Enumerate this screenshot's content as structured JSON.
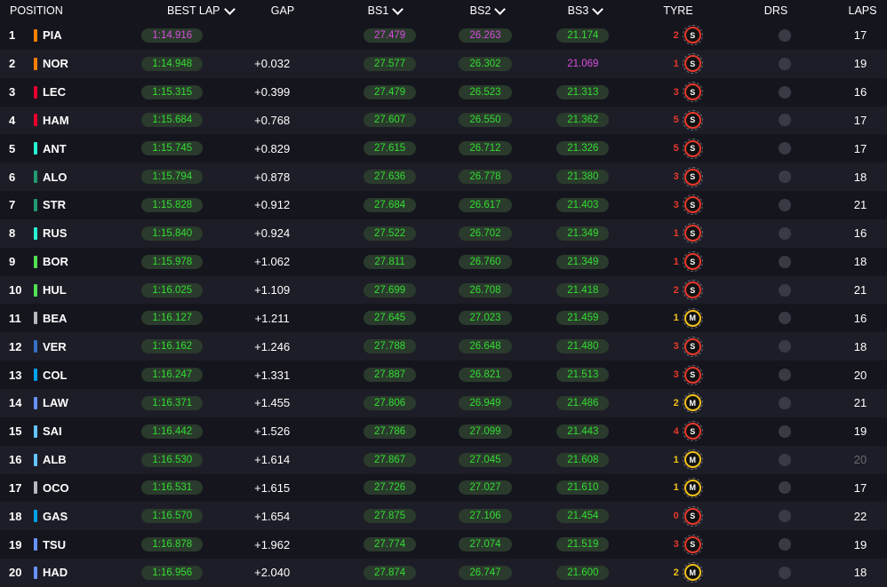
{
  "headers": {
    "position": "POSITION",
    "best_lap": "BEST LAP",
    "gap": "GAP",
    "bs1": "BS1",
    "bs2": "BS2",
    "bs3": "BS3",
    "tyre": "TYRE",
    "drs": "DRS",
    "laps": "LAPS"
  },
  "colors": {
    "pill_bg": "#2a3a2c",
    "green": "#33dd33",
    "purple": "#d94ee0",
    "soft": "#e8392b",
    "medium": "#f2c11b"
  },
  "rows": [
    {
      "pos": "1",
      "team_color": "#ff8000",
      "driver": "PIA",
      "best": "1:14.916",
      "best_purple": true,
      "gap": "",
      "bs1": "27.479",
      "bs1_purple": true,
      "bs2": "26.263",
      "bs2_purple": true,
      "bs3": "21.174",
      "bs3_purple": false,
      "tyre_age": "2",
      "tyre": "S",
      "laps": "17"
    },
    {
      "pos": "2",
      "team_color": "#ff8000",
      "driver": "NOR",
      "best": "1:14.948",
      "gap": "+0.032",
      "bs1": "27.577",
      "bs2": "26.302",
      "bs3": "21.069",
      "bs3_purple": true,
      "tyre_age": "1",
      "tyre": "S",
      "laps": "19"
    },
    {
      "pos": "3",
      "team_color": "#e8002d",
      "driver": "LEC",
      "best": "1:15.315",
      "gap": "+0.399",
      "bs1": "27.479",
      "bs2": "26.523",
      "bs3": "21.313",
      "tyre_age": "3",
      "tyre": "S",
      "laps": "16"
    },
    {
      "pos": "4",
      "team_color": "#e8002d",
      "driver": "HAM",
      "best": "1:15.684",
      "gap": "+0.768",
      "bs1": "27.607",
      "bs2": "26.550",
      "bs3": "21.362",
      "tyre_age": "5",
      "tyre": "S",
      "laps": "17"
    },
    {
      "pos": "5",
      "team_color": "#27f4d2",
      "driver": "ANT",
      "best": "1:15.745",
      "gap": "+0.829",
      "bs1": "27.615",
      "bs2": "26.712",
      "bs3": "21.326",
      "tyre_age": "5",
      "tyre": "S",
      "laps": "17"
    },
    {
      "pos": "6",
      "team_color": "#229971",
      "driver": "ALO",
      "best": "1:15.794",
      "gap": "+0.878",
      "bs1": "27.636",
      "bs2": "26.778",
      "bs3": "21.380",
      "tyre_age": "3",
      "tyre": "S",
      "laps": "18"
    },
    {
      "pos": "7",
      "team_color": "#229971",
      "driver": "STR",
      "best": "1:15.828",
      "gap": "+0.912",
      "bs1": "27.684",
      "bs2": "26.617",
      "bs3": "21.403",
      "tyre_age": "3",
      "tyre": "S",
      "laps": "21"
    },
    {
      "pos": "8",
      "team_color": "#27f4d2",
      "driver": "RUS",
      "best": "1:15.840",
      "gap": "+0.924",
      "bs1": "27.522",
      "bs2": "26.702",
      "bs3": "21.349",
      "tyre_age": "1",
      "tyre": "S",
      "laps": "16"
    },
    {
      "pos": "9",
      "team_color": "#52e252",
      "driver": "BOR",
      "best": "1:15.978",
      "gap": "+1.062",
      "bs1": "27.811",
      "bs2": "26.760",
      "bs3": "21.349",
      "tyre_age": "1",
      "tyre": "S",
      "laps": "18"
    },
    {
      "pos": "10",
      "team_color": "#52e252",
      "driver": "HUL",
      "best": "1:16.025",
      "gap": "+1.109",
      "bs1": "27.699",
      "bs2": "26.708",
      "bs3": "21.418",
      "tyre_age": "2",
      "tyre": "S",
      "laps": "21"
    },
    {
      "pos": "11",
      "team_color": "#b6babd",
      "driver": "BEA",
      "best": "1:16.127",
      "gap": "+1.211",
      "bs1": "27.645",
      "bs2": "27.023",
      "bs3": "21.459",
      "tyre_age": "1",
      "tyre": "M",
      "laps": "16"
    },
    {
      "pos": "12",
      "team_color": "#3671c6",
      "driver": "VER",
      "best": "1:16.162",
      "gap": "+1.246",
      "bs1": "27.788",
      "bs2": "26.648",
      "bs3": "21.480",
      "tyre_age": "3",
      "tyre": "S",
      "laps": "18"
    },
    {
      "pos": "13",
      "team_color": "#00a1e8",
      "driver": "COL",
      "best": "1:16.247",
      "gap": "+1.331",
      "bs1": "27.887",
      "bs2": "26.821",
      "bs3": "21.513",
      "tyre_age": "3",
      "tyre": "S",
      "laps": "20"
    },
    {
      "pos": "14",
      "team_color": "#6692ff",
      "driver": "LAW",
      "best": "1:16.371",
      "gap": "+1.455",
      "bs1": "27.806",
      "bs2": "26.949",
      "bs3": "21.486",
      "tyre_age": "2",
      "tyre": "M",
      "laps": "21"
    },
    {
      "pos": "15",
      "team_color": "#64c4ff",
      "driver": "SAI",
      "best": "1:16.442",
      "gap": "+1.526",
      "bs1": "27.786",
      "bs2": "27.099",
      "bs3": "21.443",
      "tyre_age": "4",
      "tyre": "S",
      "laps": "19"
    },
    {
      "pos": "16",
      "team_color": "#64c4ff",
      "driver": "ALB",
      "best": "1:16.530",
      "gap": "+1.614",
      "bs1": "27.867",
      "bs2": "27.045",
      "bs3": "21.608",
      "tyre_age": "1",
      "tyre": "M",
      "laps": "20",
      "laps_dim": true
    },
    {
      "pos": "17",
      "team_color": "#b6babd",
      "driver": "OCO",
      "best": "1:16.531",
      "gap": "+1.615",
      "bs1": "27.726",
      "bs2": "27.027",
      "bs3": "21.610",
      "tyre_age": "1",
      "tyre": "M",
      "laps": "17"
    },
    {
      "pos": "18",
      "team_color": "#00a1e8",
      "driver": "GAS",
      "best": "1:16.570",
      "gap": "+1.654",
      "bs1": "27.875",
      "bs2": "27.106",
      "bs3": "21.454",
      "tyre_age": "0",
      "tyre": "S",
      "laps": "22"
    },
    {
      "pos": "19",
      "team_color": "#6692ff",
      "driver": "TSU",
      "best": "1:16.878",
      "gap": "+1.962",
      "bs1": "27.774",
      "bs2": "27.074",
      "bs3": "21.519",
      "tyre_age": "3",
      "tyre": "S",
      "laps": "19"
    },
    {
      "pos": "20",
      "team_color": "#6692ff",
      "driver": "HAD",
      "best": "1:16.956",
      "gap": "+2.040",
      "bs1": "27.874",
      "bs2": "26.747",
      "bs3": "21.600",
      "tyre_age": "2",
      "tyre": "M",
      "laps": "18"
    }
  ]
}
